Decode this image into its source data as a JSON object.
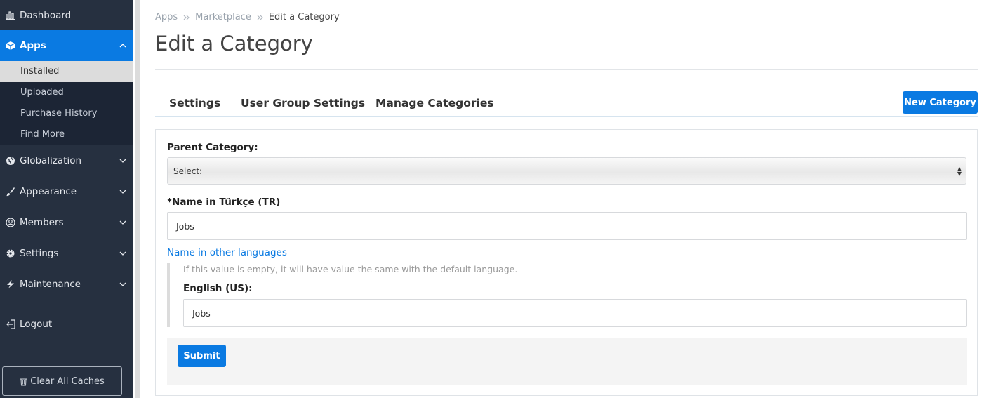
{
  "sidebar": {
    "items": [
      {
        "label": "Dashboard",
        "icon": "chart-bar-icon"
      },
      {
        "label": "Apps",
        "icon": "cube-icon",
        "active": true,
        "expanded": true
      },
      {
        "label": "Globalization",
        "icon": "globe-icon"
      },
      {
        "label": "Appearance",
        "icon": "brush-icon"
      },
      {
        "label": "Members",
        "icon": "user-circle-icon"
      },
      {
        "label": "Settings",
        "icon": "gear-icon"
      },
      {
        "label": "Maintenance",
        "icon": "bolt-icon"
      },
      {
        "label": "Logout",
        "icon": "logout-icon"
      }
    ],
    "apps_submenu": [
      "Installed",
      "Uploaded",
      "Purchase History",
      "Find More"
    ],
    "clear_caches_label": "Clear All Caches"
  },
  "breadcrumb": [
    "Apps",
    "Marketplace",
    "Edit a Category"
  ],
  "page_title": "Edit a Category",
  "tabs": [
    "Settings",
    "User Group Settings",
    "Manage Categories"
  ],
  "new_category_label": "New Category",
  "form": {
    "parent_category_label": "Parent Category:",
    "parent_category_value": "Select:",
    "name_label": "*Name in Türkçe (TR)",
    "name_value": "Jobs",
    "other_languages_link": "Name in other languages",
    "other_languages_hint": "If this value is empty, it will have value the same with the default language.",
    "english_label": "English (US):",
    "english_value": "Jobs",
    "submit_label": "Submit"
  },
  "colors": {
    "sidebar_bg": "#263040",
    "accent": "#0a7ae2",
    "submenu_bg": "#1c2535"
  }
}
